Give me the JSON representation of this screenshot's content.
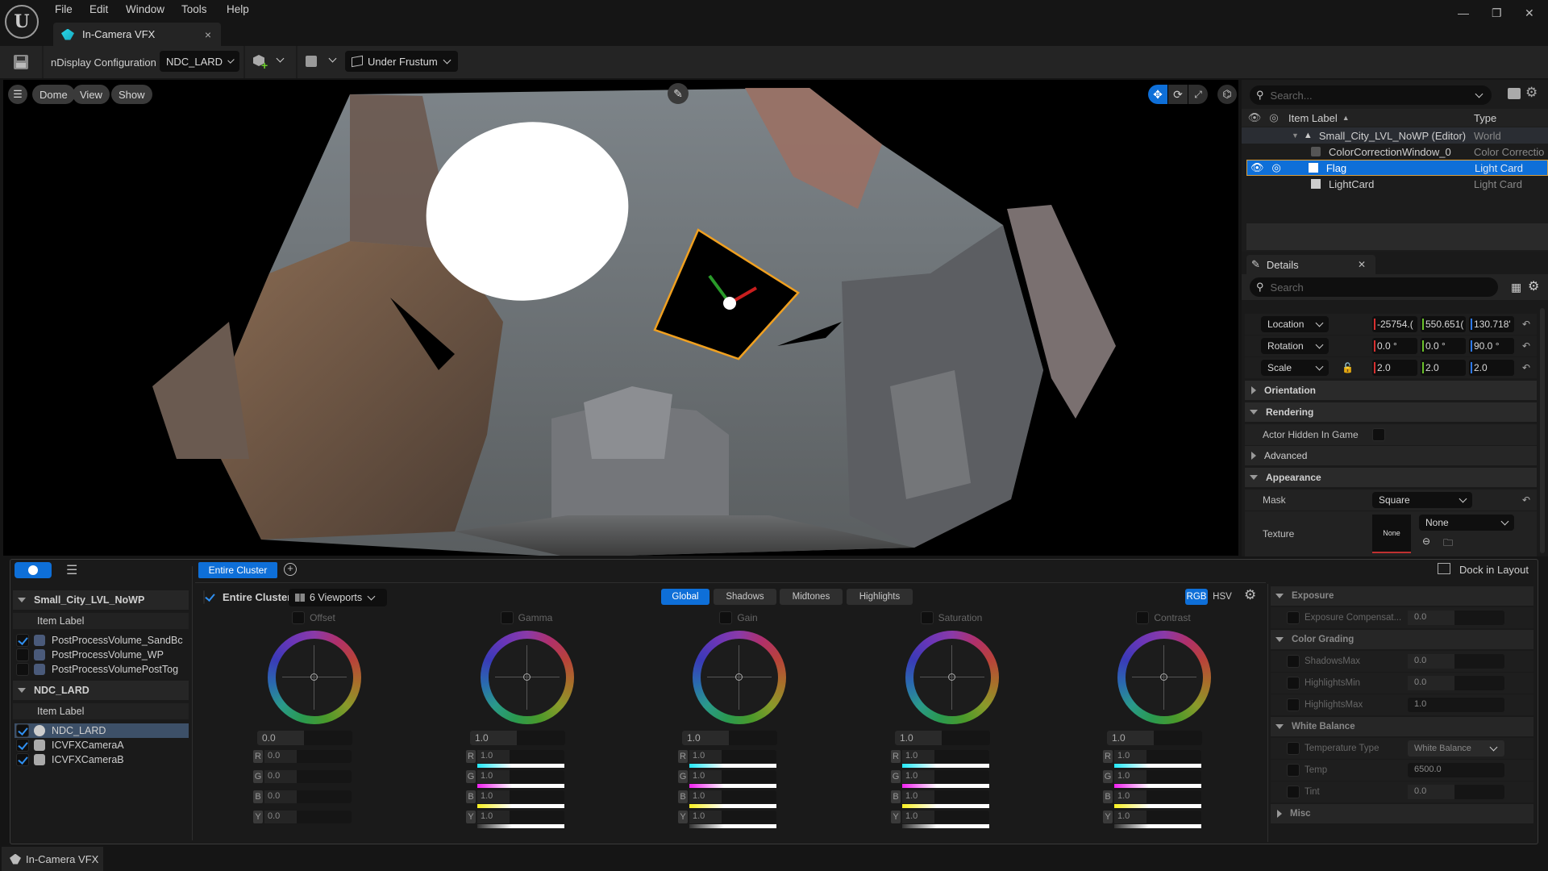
{
  "menu": [
    "File",
    "Edit",
    "Window",
    "Tools",
    "Help"
  ],
  "document_tab": {
    "title": "In-Camera VFX",
    "close": "×"
  },
  "window_controls": {
    "minimize": "—",
    "restore": "❐",
    "close": "✕"
  },
  "toolbar": {
    "config_label": "nDisplay Configuration",
    "config_value": "NDC_LARD",
    "projection_mode": "Under Frustum"
  },
  "viewport": {
    "menu_buttons": [
      "Dome",
      "View",
      "Show"
    ],
    "transform_modes": [
      "translate",
      "rotate",
      "scale"
    ],
    "active_transform": "translate"
  },
  "outliner": {
    "search_placeholder": "Search...",
    "col_label": "Item Label",
    "col_type": "Type",
    "items": [
      {
        "label": "Small_City_LVL_NoWP (Editor)",
        "type": "World",
        "indent": 0
      },
      {
        "label": "ColorCorrectionWindow_0",
        "type": "Color Correctio",
        "indent": 1
      },
      {
        "label": "Flag",
        "type": "Light Card",
        "indent": 1,
        "selected": true
      },
      {
        "label": "LightCard",
        "type": "Light Card",
        "indent": 1
      }
    ]
  },
  "details": {
    "tab_title": "Details",
    "search_placeholder": "Search",
    "transform": [
      {
        "label": "Location",
        "x": "-25754.(",
        "y": "550.651(",
        "z": "130.718'"
      },
      {
        "label": "Rotation",
        "x": "0.0 °",
        "y": "0.0 °",
        "z": "90.0 °"
      },
      {
        "label": "Scale",
        "x": "2.0",
        "y": "2.0",
        "z": "2.0"
      }
    ],
    "sections": {
      "orientation": "Orientation",
      "rendering": "Rendering",
      "actor_hidden": "Actor Hidden In Game",
      "advanced": "Advanced",
      "appearance": "Appearance",
      "mask_label": "Mask",
      "mask_value": "Square",
      "texture_label": "Texture",
      "texture_thumb": "None",
      "texture_value": "None"
    }
  },
  "color_panel": {
    "active_tab": "Entire Cluster",
    "dock_label": "Dock in Layout",
    "groups": [
      {
        "title": "Small_City_LVL_NoWP",
        "col": "Item Label",
        "items": [
          {
            "label": "PostProcessVolume_SandBc",
            "checked": true
          },
          {
            "label": "PostProcessVolume_WP",
            "checked": false
          },
          {
            "label": "PostProcessVolumePostTog",
            "checked": false
          }
        ]
      },
      {
        "title": "NDC_LARD",
        "col": "Item Label",
        "items": [
          {
            "label": "NDC_LARD",
            "checked": true,
            "selected": true
          },
          {
            "label": "ICVFXCameraA",
            "checked": true
          },
          {
            "label": "ICVFXCameraB",
            "checked": true
          }
        ]
      }
    ],
    "target_label": "Entire Cluster",
    "viewports": "6 Viewports",
    "range_tabs": [
      "Global",
      "Shadows",
      "Midtones",
      "Highlights"
    ],
    "active_range": "Global",
    "color_modes": [
      "RGB",
      "HSV"
    ],
    "active_mode": "RGB",
    "wheels": [
      {
        "name": "Offset",
        "main": "0.0",
        "r": "0.0",
        "g": "0.0",
        "b": "0.0",
        "y": "0.0",
        "gradients": false
      },
      {
        "name": "Gamma",
        "main": "1.0",
        "r": "1.0",
        "g": "1.0",
        "b": "1.0",
        "y": "1.0",
        "gradients": true
      },
      {
        "name": "Gain",
        "main": "1.0",
        "r": "1.0",
        "g": "1.0",
        "b": "1.0",
        "y": "1.0",
        "gradients": true
      },
      {
        "name": "Saturation",
        "main": "1.0",
        "r": "1.0",
        "g": "1.0",
        "b": "1.0",
        "y": "1.0",
        "gradients": true
      },
      {
        "name": "Contrast",
        "main": "1.0",
        "r": "1.0",
        "g": "1.0",
        "b": "1.0",
        "y": "1.0",
        "gradients": true
      }
    ],
    "settings": {
      "exposure": "Exposure",
      "exposure_comp": {
        "label": "Exposure Compensat...",
        "value": "0.0"
      },
      "color_grading": "Color Grading",
      "shadows_max": {
        "label": "ShadowsMax",
        "value": "0.0"
      },
      "highlights_min": {
        "label": "HighlightsMin",
        "value": "0.0"
      },
      "highlights_max": {
        "label": "HighlightsMax",
        "value": "1.0"
      },
      "white_balance": "White Balance",
      "temp_type": {
        "label": "Temperature Type",
        "value": "White Balance"
      },
      "temp": {
        "label": "Temp",
        "value": "6500.0"
      },
      "tint": {
        "label": "Tint",
        "value": "0.0"
      },
      "misc": "Misc"
    }
  },
  "statusbar": {
    "tab": "In-Camera VFX"
  },
  "colors": {
    "accent": "#0e6fd8",
    "selection": "#0e6fd8",
    "panel": "#1a1a1a"
  }
}
